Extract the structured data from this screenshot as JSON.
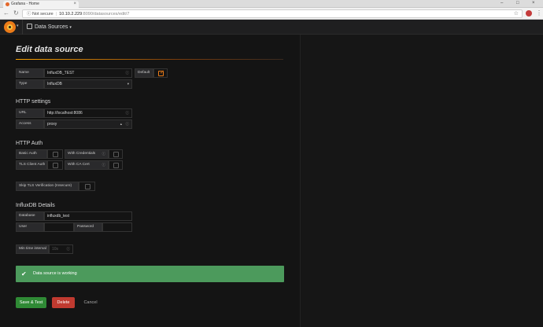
{
  "browser": {
    "tab_title": "Grafana - Home",
    "security_label": "Not secure",
    "url_host": "10.10.2.229",
    "url_path": ":8090/datasources/edit/7"
  },
  "navbar": {
    "breadcrumb": "Data Sources"
  },
  "page": {
    "title": "Edit data source"
  },
  "general": {
    "name_label": "Name",
    "name_value": "InfluxDB_TEST",
    "default_label": "Default",
    "default_checked": true,
    "type_label": "Type",
    "type_value": "InfluxDB"
  },
  "http_settings": {
    "heading": "HTTP settings",
    "url_label": "URL",
    "url_value": "http://localhost:8086",
    "access_label": "Access",
    "access_value": "proxy"
  },
  "http_auth": {
    "heading": "HTTP Auth",
    "basic_auth_label": "Basic Auth",
    "with_credentials_label": "With Credentials",
    "tls_client_auth_label": "TLS Client Auth",
    "with_ca_cert_label": "With CA Cert",
    "skip_tls_label": "Skip TLS Verification (Insecure)"
  },
  "influx": {
    "heading": "InfluxDB Details",
    "database_label": "Database",
    "database_value": "influxdb_test",
    "user_label": "User",
    "password_label": "Password",
    "min_time_label": "Min time interval",
    "min_time_placeholder": "10s"
  },
  "status": {
    "message": "Data source is working"
  },
  "actions": {
    "save_label": "Save & Test",
    "delete_label": "Delete",
    "cancel_label": "Cancel"
  },
  "colors": {
    "accent": "#eb7b18",
    "success": "#4c9a5c",
    "save": "#2f8a35",
    "delete": "#c03a30"
  }
}
